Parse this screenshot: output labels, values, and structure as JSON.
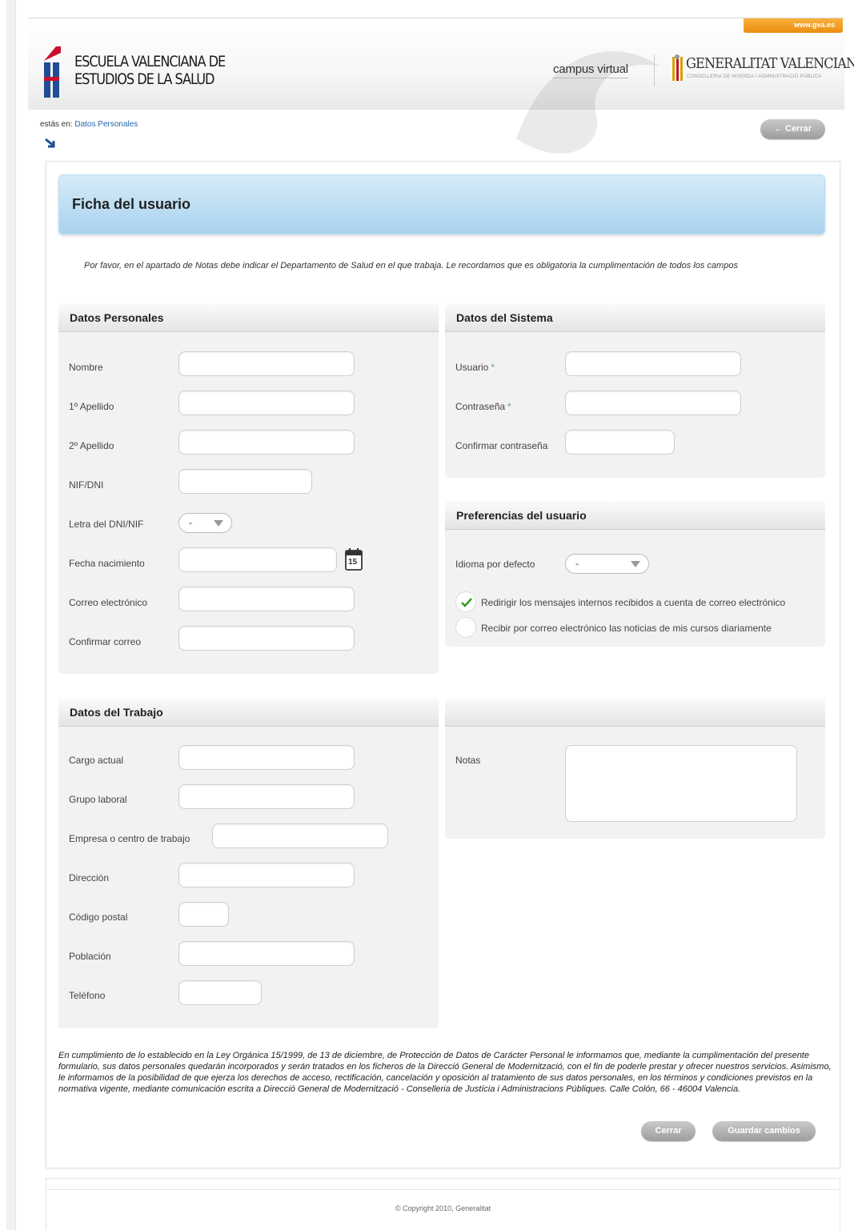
{
  "header": {
    "gva_link": "www.gva.es",
    "school_line1": "ESCUELA VALENCIANA DE",
    "school_line2": "ESTUDIOS DE LA SALUD",
    "campus": "campus virtual",
    "gv_title": "GENERALITAT VALENCIANA",
    "gv_subtitle": "CONSELLERIA DE HISENDA I ADMINISTRACIÓ PÚBLICA"
  },
  "breadcrumb": {
    "prefix": "estás en:",
    "current": "Datos Personales"
  },
  "top_close_label": "Cerrar",
  "title": "Ficha del usuario",
  "intro": "Por favor, en el apartado de Notas debe indicar el Departamento de Salud en el que trabaja. Le recordamos que es obligatoria la cumplimentación de todos los campos",
  "personal": {
    "heading": "Datos Personales",
    "nombre": "Nombre",
    "apellido1": "1º Apellido",
    "apellido2": "2º Apellido",
    "nif": "NIF/DNI",
    "letra": "Letra del DNI/NIF",
    "letra_value": "-",
    "fecha": "Fecha nacimiento",
    "calendar_day": "15",
    "correo": "Correo electrónico",
    "confirmar_correo": "Confirmar correo"
  },
  "sistema": {
    "heading": "Datos del Sistema",
    "usuario": "Usuario",
    "contrasena": "Contraseña",
    "confirmar": "Confirmar contraseña",
    "required_mark": "*"
  },
  "preferencias": {
    "heading": "Preferencias del usuario",
    "idioma": "Idioma por defecto",
    "idioma_value": "-",
    "redirigir": "Redirigir los mensajes internos recibidos a cuenta de correo electrónico",
    "redirigir_checked": true,
    "recibir": "Recibir por correo electrónico las noticias de mis cursos diariamente",
    "recibir_checked": false
  },
  "trabajo": {
    "heading": "Datos del Trabajo",
    "cargo": "Cargo actual",
    "grupo": "Grupo laboral",
    "empresa": "Empresa o centro de trabajo",
    "direccion": "Dirección",
    "cp": "Código postal",
    "poblacion": "Población",
    "telefono": "Teléfono"
  },
  "notas": {
    "label": "Notas"
  },
  "legal": "En cumplimiento de lo establecido en la Ley Orgánica 15/1999, de 13 de diciembre, de Protección de Datos de Carácter Personal le informamos que, mediante la cumplimentación del presente formulario, sus datos personales quedarán incorporados y serán tratados en los ficheros de la Direcció General de Modernització, con el fin de poderle prestar y ofrecer nuestros servicios. Asimismo, le informamos de la posibilidad de que ejerza los derechos de acceso, rectificación, cancelación y oposición al tratamiento de sus datos personales, en los términos y condiciones previstos en la normativa vigente, mediante comunicación escrita a Direcció General de Modernització - Conselleria de Justícia i Administracions Públiques. Calle Colón, 66 - 46004 Valencia.",
  "buttons": {
    "cerrar": "Cerrar",
    "guardar": "Guardar cambios"
  },
  "footer": {
    "copyright": "© Copyright 2010, Generalitat"
  },
  "colors": {
    "accent_blue": "#a9d3ef",
    "link": "#2468a8",
    "orange": "#ec8d12",
    "check_green": "#3a9a2a"
  }
}
